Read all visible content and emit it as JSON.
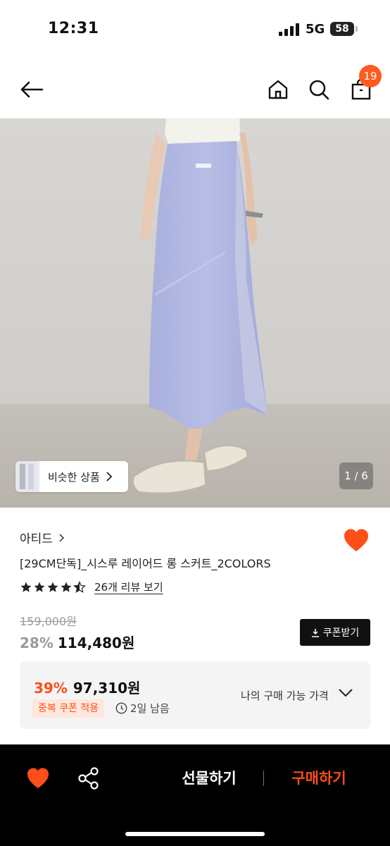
{
  "status_bar": {
    "time": "12:31",
    "network": "5G",
    "battery": "58"
  },
  "header": {
    "icons": [
      "back-arrow-icon",
      "home-icon",
      "search-icon",
      "shopping-bag-icon"
    ],
    "cart_count": "19"
  },
  "gallery": {
    "similar_label": "비슷한 상품",
    "counter": "1 / 6"
  },
  "product": {
    "brand": "아티드",
    "name": "[29CM단독]_시스루 레이어드 롱 스커트_2COLORS",
    "rating": 4.5,
    "review_link": "26개 리뷰 보기",
    "original_price": "159,000원",
    "discount_rate": "28%",
    "sale_price": "114,480원",
    "coupon_button": "쿠폰받기"
  },
  "benefit": {
    "rate": "39%",
    "price": "97,310원",
    "coupon_tag": "중복 쿠폰 적용",
    "time_left": "2일 남음",
    "my_price_label": "나의 구매 가능 가격"
  },
  "bottom_bar": {
    "gift_label": "선물하기",
    "buy_label": "구매하기"
  },
  "colors": {
    "accent": "#ff4e17",
    "badge": "#ff5a1f",
    "bar_background": "#000000"
  }
}
